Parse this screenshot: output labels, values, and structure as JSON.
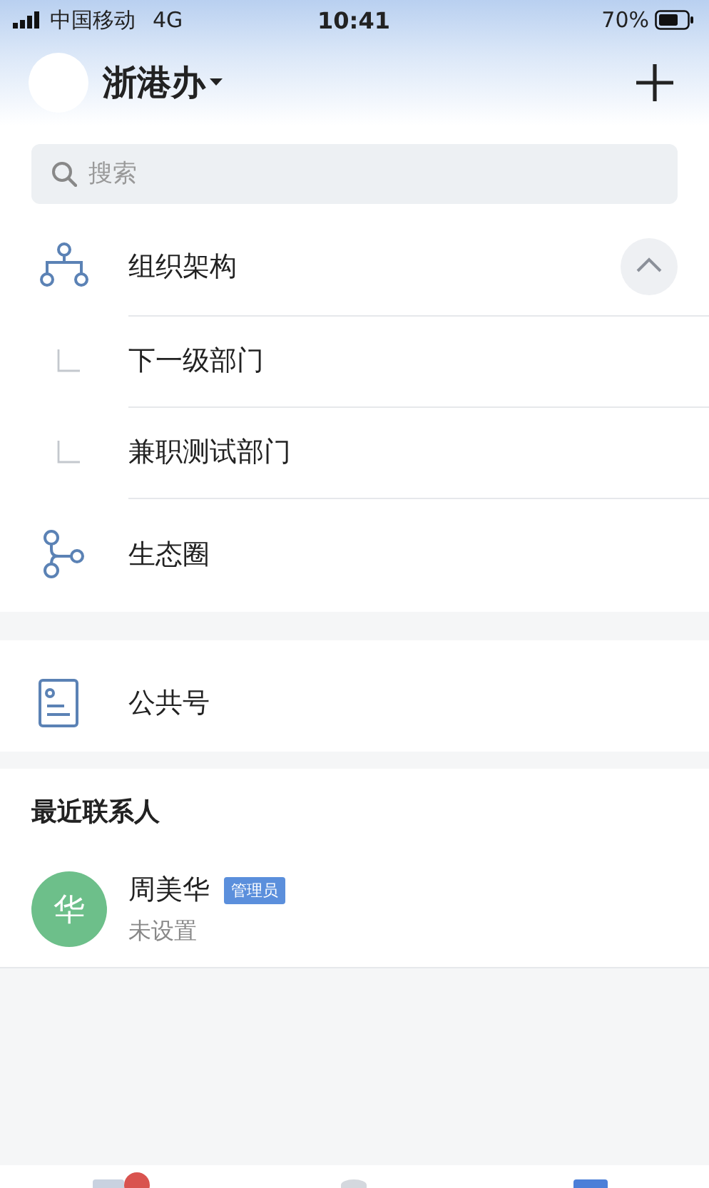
{
  "status_bar": {
    "carrier": "中国移动",
    "network": "4G",
    "time": "10:41",
    "battery_text": "70%"
  },
  "header": {
    "title": "浙港办"
  },
  "search": {
    "placeholder": "搜索"
  },
  "directory": [
    {
      "kind": "org",
      "label": "组织架构",
      "expanded": true,
      "children": [
        {
          "label": "下一级部门"
        },
        {
          "label": "兼职测试部门"
        }
      ]
    },
    {
      "kind": "eco",
      "label": "生态圈"
    }
  ],
  "public": {
    "label": "公共号"
  },
  "recent": {
    "title": "最近联系人",
    "contacts": [
      {
        "avatar": "华",
        "color": "#6dbf8a",
        "name": "周美华",
        "badge": "管理员",
        "subtitle": "未设置"
      }
    ]
  }
}
